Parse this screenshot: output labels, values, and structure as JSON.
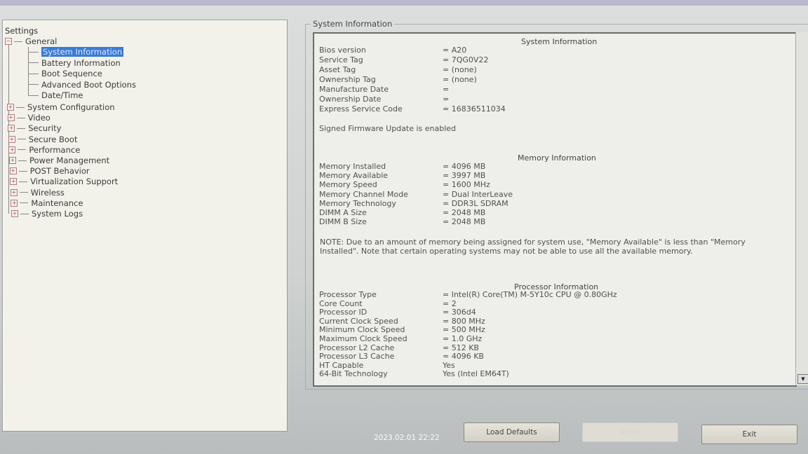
{
  "tree": {
    "root": "Settings",
    "general": {
      "label": "General",
      "children": [
        "System Information",
        "Battery Information",
        "Boot Sequence",
        "Advanced Boot Options",
        "Date/Time"
      ],
      "selected": "System Information"
    },
    "categories": [
      "System Configuration",
      "Video",
      "Security",
      "Secure Boot",
      "Performance",
      "Power Management",
      "POST Behavior",
      "Virtualization Support",
      "Wireless",
      "Maintenance",
      "System Logs"
    ]
  },
  "panel": {
    "group_title": "System Information",
    "system": {
      "title": "System Information",
      "rows": [
        {
          "k": "Bios version",
          "v": "= A20"
        },
        {
          "k": "Service Tag",
          "v": "= 7QG0V22"
        },
        {
          "k": "Asset Tag",
          "v": "= (none)"
        },
        {
          "k": "Ownership Tag",
          "v": "= (none)"
        },
        {
          "k": "Manufacture Date",
          "v": "="
        },
        {
          "k": "Ownership Date",
          "v": "="
        },
        {
          "k": "Express Service Code",
          "v": "= 16836511034"
        }
      ],
      "firmware_note": "Signed Firmware Update is enabled"
    },
    "memory": {
      "title": "Memory Information",
      "rows": [
        {
          "k": "Memory Installed",
          "v": "= 4096 MB"
        },
        {
          "k": "Memory Available",
          "v": "= 3997 MB"
        },
        {
          "k": "Memory Speed",
          "v": "= 1600 MHz"
        },
        {
          "k": "Memory Channel Mode",
          "v": "= Dual InterLeave"
        },
        {
          "k": "Memory Technology",
          "v": "= DDR3L SDRAM"
        },
        {
          "k": "DIMM A Size",
          "v": "= 2048 MB"
        },
        {
          "k": "DIMM B Size",
          "v": "= 2048 MB"
        }
      ],
      "note": "NOTE: Due to an amount of memory being assigned for system use, \"Memory Available\" is less than \"Memory Installed\". Note that certain operating systems may not be able to use all the available memory."
    },
    "processor": {
      "title": "Processor Information",
      "rows": [
        {
          "k": "Processor Type",
          "v": "= Intel(R) Core(TM) M-5Y10c CPU @ 0.80GHz"
        },
        {
          "k": "Core Count",
          "v": "= 2"
        },
        {
          "k": "Processor ID",
          "v": "= 306d4"
        },
        {
          "k": "Current Clock Speed",
          "v": "= 800 MHz"
        },
        {
          "k": "Minimum Clock Speed",
          "v": "= 500 MHz"
        },
        {
          "k": "Maximum Clock Speed",
          "v": "= 1.0 GHz"
        },
        {
          "k": "Processor L2 Cache",
          "v": "= 512 KB"
        },
        {
          "k": "Processor L3 Cache",
          "v": "= 4096 KB"
        },
        {
          "k": "HT Capable",
          "v": "Yes"
        },
        {
          "k": "64-Bit Technology",
          "v": "Yes (Intel EM64T)"
        }
      ]
    }
  },
  "buttons": {
    "load_defaults": "Load Defaults",
    "apply": "Apply",
    "exit": "Exit"
  },
  "timestamp": "2023.02.01 22:22"
}
